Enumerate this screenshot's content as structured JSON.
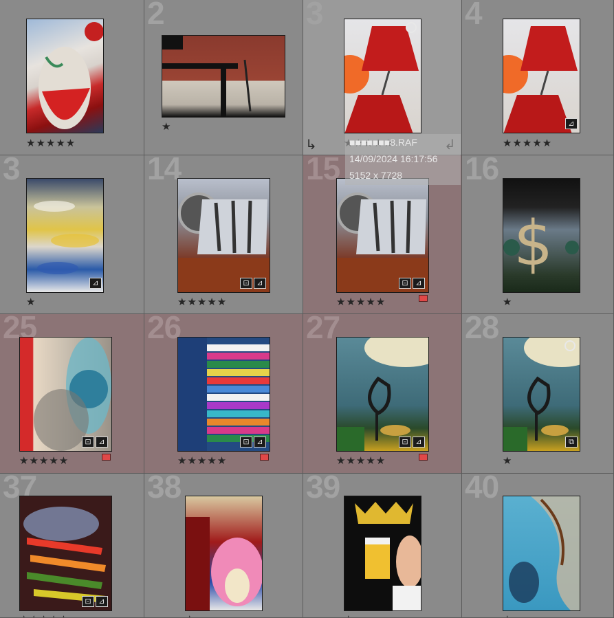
{
  "grid": {
    "cells": [
      {
        "index": "",
        "stars": "★★★★★",
        "selected": false,
        "hover": false,
        "badges": [],
        "label": false,
        "circle": false,
        "thumb_icon": "red-mask-photo"
      },
      {
        "index": "2",
        "stars": "★",
        "selected": false,
        "hover": false,
        "badges": [],
        "label": false,
        "circle": false,
        "thumb_icon": "brick-wall-photo"
      },
      {
        "index": "3",
        "stars": "★★★★★",
        "selected": false,
        "hover": true,
        "badges": [],
        "label": false,
        "circle": true,
        "thumb_icon": "red-lamp-photo"
      },
      {
        "index": "4",
        "stars": "★★★★★",
        "selected": false,
        "hover": false,
        "badges": [
          "⊿"
        ],
        "label": false,
        "circle": false,
        "thumb_icon": "red-lamp-photo"
      },
      {
        "index": "3",
        "stars": "★",
        "selected": false,
        "hover": false,
        "badges": [
          "⊿"
        ],
        "label": false,
        "circle": false,
        "thumb_icon": "blurred-crowd-photo"
      },
      {
        "index": "14",
        "stars": "★★★★★",
        "selected": false,
        "hover": false,
        "badges": [
          "⊡",
          "⊿"
        ],
        "label": false,
        "circle": false,
        "thumb_icon": "chrome-cup-photo"
      },
      {
        "index": "15",
        "stars": "★★★★★",
        "selected": true,
        "hover": false,
        "badges": [
          "⊡",
          "⊿"
        ],
        "label": true,
        "circle": false,
        "thumb_icon": "chrome-cup-photo"
      },
      {
        "index": "16",
        "stars": "★",
        "selected": false,
        "hover": false,
        "badges": [],
        "label": false,
        "circle": false,
        "thumb_icon": "dollar-sign-photo"
      },
      {
        "index": "25",
        "stars": "★★★★★",
        "selected": true,
        "hover": false,
        "badges": [
          "⊡",
          "⊿"
        ],
        "label": true,
        "circle": false,
        "thumb_icon": "blue-glass-photo"
      },
      {
        "index": "26",
        "stars": "★★★★★",
        "selected": true,
        "hover": false,
        "badges": [
          "⊡",
          "⊿"
        ],
        "label": true,
        "circle": false,
        "thumb_icon": "striped-fabric-photo"
      },
      {
        "index": "27",
        "stars": "★★★★★",
        "selected": true,
        "hover": false,
        "badges": [
          "⊡",
          "⊿"
        ],
        "label": true,
        "circle": false,
        "thumb_icon": "teal-vessel-photo"
      },
      {
        "index": "28",
        "stars": "★",
        "selected": false,
        "hover": false,
        "badges": [
          "⧉"
        ],
        "label": false,
        "circle": true,
        "thumb_icon": "teal-vessel-photo"
      },
      {
        "index": "37",
        "stars": "★★★★★",
        "selected": false,
        "hover": false,
        "badges": [
          "⊡",
          "⊿"
        ],
        "label": false,
        "circle": false,
        "thumb_icon": "colorful-spoons-photo"
      },
      {
        "index": "38",
        "stars": "★",
        "selected": false,
        "hover": false,
        "badges": [],
        "label": false,
        "circle": false,
        "thumb_icon": "painted-plate-photo"
      },
      {
        "index": "39",
        "stars": "★",
        "selected": false,
        "hover": false,
        "badges": [],
        "label": false,
        "circle": false,
        "thumb_icon": "beer-poster-photo"
      },
      {
        "index": "40",
        "stars": "★",
        "selected": false,
        "hover": false,
        "badges": [],
        "label": false,
        "circle": false,
        "thumb_icon": "blue-wall-photo"
      }
    ]
  },
  "hover_info": {
    "filename": "■■■■■■■8.RAF",
    "datetime": "14/09/2024 16:17:56",
    "dimensions": "5152 x 7728"
  },
  "icons": {
    "rotate_left": "↳",
    "rotate_right": "↲"
  },
  "colors": {
    "label_red": "#e04848",
    "selected_bg": "#8c7476"
  }
}
